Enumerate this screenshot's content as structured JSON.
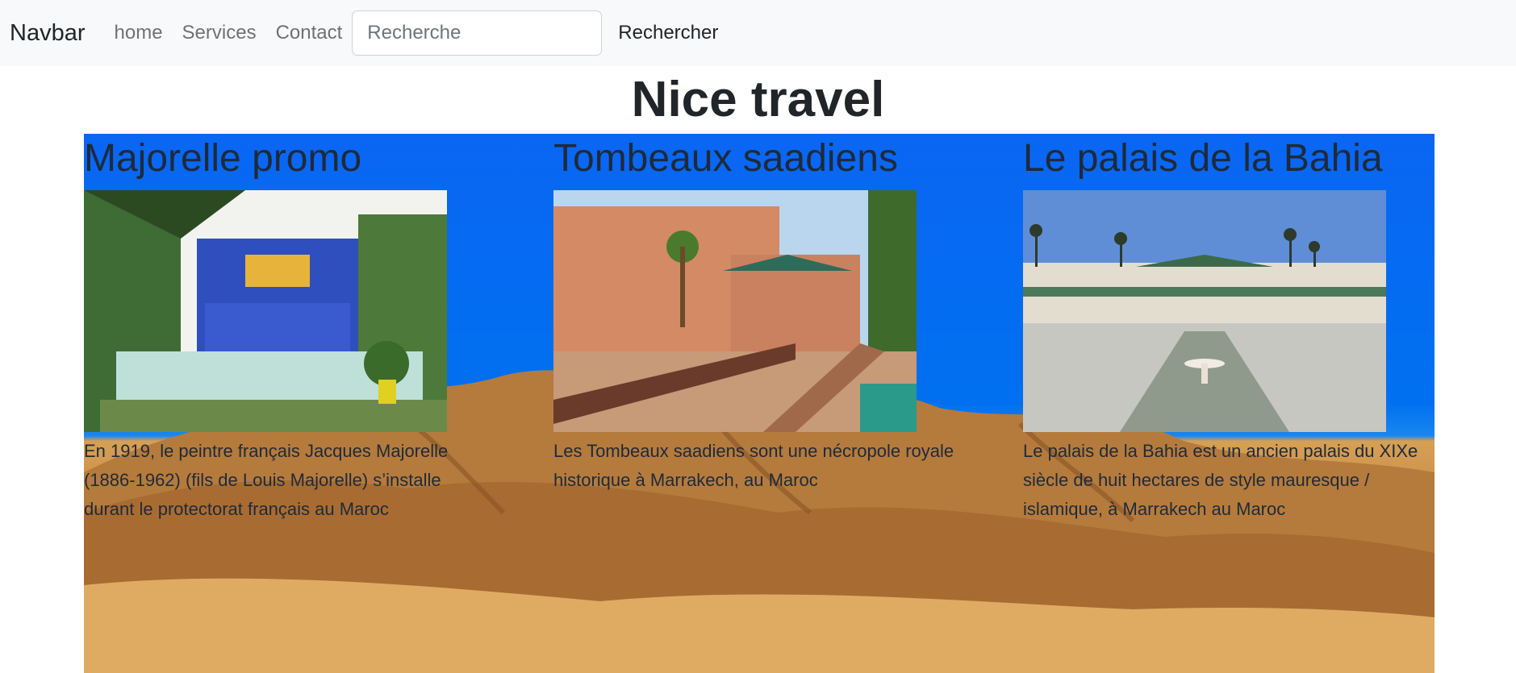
{
  "navbar": {
    "brand": "Navbar",
    "links": [
      "home",
      "Services",
      "Contact"
    ],
    "search_placeholder": "Recherche",
    "search_button": "Rechercher"
  },
  "page": {
    "title": "Nice travel"
  },
  "places": [
    {
      "title": "Majorelle promo",
      "text": "En 1919, le peintre français Jacques Majorelle (1886-1962) (fils de Louis Majorelle) s’installe durant le protectorat français au Maroc"
    },
    {
      "title": "Tombeaux saadiens",
      "text": "Les Tombeaux saadiens sont une nécropole royale historique à Marrakech, au Maroc"
    },
    {
      "title": "Le palais de la Bahia",
      "text": "Le palais de la Bahia est un ancien palais du XIXe siècle de huit hectares de style mauresque / islamique, à Marrakech au Maroc"
    }
  ],
  "colors": {
    "sky": "#0a66f3",
    "sand": "#d6a054",
    "navbar_bg": "#f8f9fa"
  }
}
